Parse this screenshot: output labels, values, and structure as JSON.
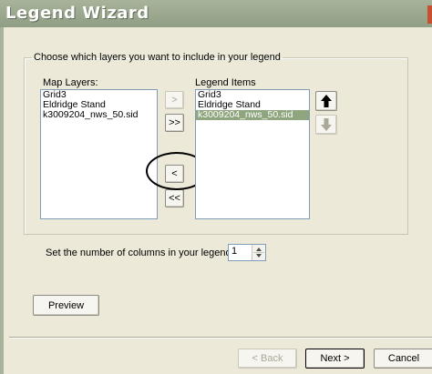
{
  "window": {
    "title": "Legend Wizard"
  },
  "group": {
    "legend": "Choose which layers you want to include in your legend"
  },
  "map_layers": {
    "label": "Map Layers:",
    "items": [
      "Grid3",
      "Eldridge Stand",
      "k3009204_nws_50.sid"
    ]
  },
  "legend_items": {
    "label": "Legend Items",
    "items": [
      "Grid3",
      "Eldridge Stand",
      "k3009204_nws_50.sid"
    ],
    "selected_index": 2
  },
  "transfer_buttons": {
    "add_one": ">",
    "add_all": ">>",
    "remove_one": "<",
    "remove_all": "<<"
  },
  "order_buttons": {
    "up_icon": "arrow-up-icon",
    "down_icon": "arrow-down-icon"
  },
  "columns": {
    "label": "Set the number of columns in your legend:",
    "value": "1"
  },
  "preview_button": "Preview",
  "nav": {
    "back": "< Back",
    "next": "Next >",
    "cancel": "Cancel"
  },
  "colors": {
    "selection": "#8fa57e",
    "title_bar": "#a7b39a",
    "dialog_bg": "#ece9d8",
    "annotation_circle": "#000000"
  }
}
